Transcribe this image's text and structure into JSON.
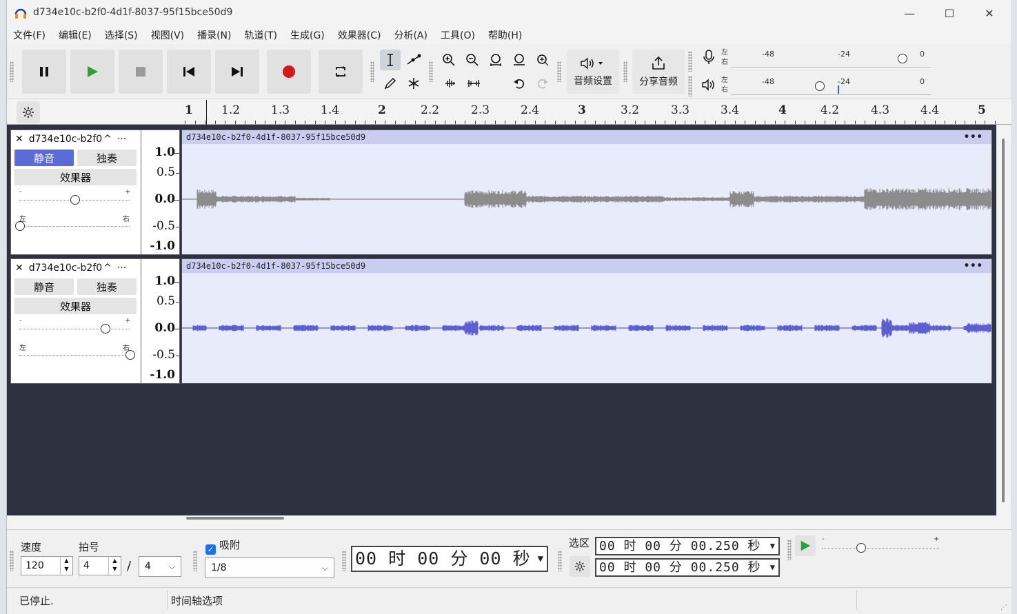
{
  "window": {
    "title": "d734e10c-b2f0-4d1f-8037-95f15bce50d9",
    "minimize": "—",
    "maximize": "☐",
    "close": "✕"
  },
  "menu": [
    "文件(F)",
    "编辑(E)",
    "选择(S)",
    "视图(V)",
    "播录(N)",
    "轨道(T)",
    "生成(G)",
    "效果器(C)",
    "分析(A)",
    "工具(O)",
    "帮助(H)"
  ],
  "toolbar": {
    "audio_setup": "音频设置",
    "share_audio": "分享音频"
  },
  "meters": {
    "record": {
      "left": "左",
      "right": "右",
      "ticks": [
        "-48",
        "-24",
        "0"
      ]
    },
    "play": {
      "left": "左",
      "right": "右",
      "ticks": [
        "-48",
        "-24",
        "0"
      ]
    }
  },
  "ruler": {
    "labels": [
      {
        "t": "1",
        "major": true
      },
      {
        "t": "1.2",
        "major": false
      },
      {
        "t": "1.3",
        "major": false
      },
      {
        "t": "1.4",
        "major": false
      },
      {
        "t": "2",
        "major": true
      },
      {
        "t": "2.2",
        "major": false
      },
      {
        "t": "2.3",
        "major": false
      },
      {
        "t": "2.4",
        "major": false
      },
      {
        "t": "3",
        "major": true
      },
      {
        "t": "3.2",
        "major": false
      },
      {
        "t": "3.3",
        "major": false
      },
      {
        "t": "3.4",
        "major": false
      },
      {
        "t": "4",
        "major": true
      },
      {
        "t": "4.2",
        "major": false
      },
      {
        "t": "4.3",
        "major": false
      },
      {
        "t": "4.4",
        "major": false
      },
      {
        "t": "5",
        "major": true
      }
    ]
  },
  "tracks": [
    {
      "name": "d734e10c-b2f0",
      "mute": "静音",
      "solo": "独奏",
      "effects": "效果器",
      "mute_on": true,
      "gain_minus": "-",
      "gain_plus": "+",
      "pan_left": "左",
      "pan_right": "右",
      "scale": [
        "1.0",
        "0.5",
        "0.0",
        "-0.5",
        "-1.0"
      ],
      "clip_name": "d734e10c-b2f0-4d1f-8037-95f15bce50d9",
      "clip_menu": "•••",
      "color": "#8c8c8c"
    },
    {
      "name": "d734e10c-b2f0",
      "mute": "静音",
      "solo": "独奏",
      "effects": "效果器",
      "mute_on": false,
      "gain_minus": "-",
      "gain_plus": "+",
      "pan_left": "左",
      "pan_right": "右",
      "scale": [
        "1.0",
        "0.5",
        "0.0",
        "-0.5",
        "-1.0"
      ],
      "clip_name": "d734e10c-b2f0-4d1f-8037-95f15bce50d9",
      "clip_menu": "•••",
      "color": "#5b5fd0"
    }
  ],
  "bottom": {
    "tempo_label": "速度",
    "tempo_value": "120",
    "timesig_label": "拍号",
    "timesig_num": "4",
    "timesig_sep": "/",
    "timesig_den": "4",
    "snap_label": "吸附",
    "snap_value": "1/8",
    "time_display": "00 时 00 分 00 秒",
    "selection_label": "选区",
    "sel_start": "00 时 00 分 00.250 秒",
    "sel_end": "00 时 00 分 00.250 秒",
    "speed_minus": "-",
    "speed_plus": "+"
  },
  "status": {
    "state": "已停止.",
    "hint": "时间轴选项"
  }
}
